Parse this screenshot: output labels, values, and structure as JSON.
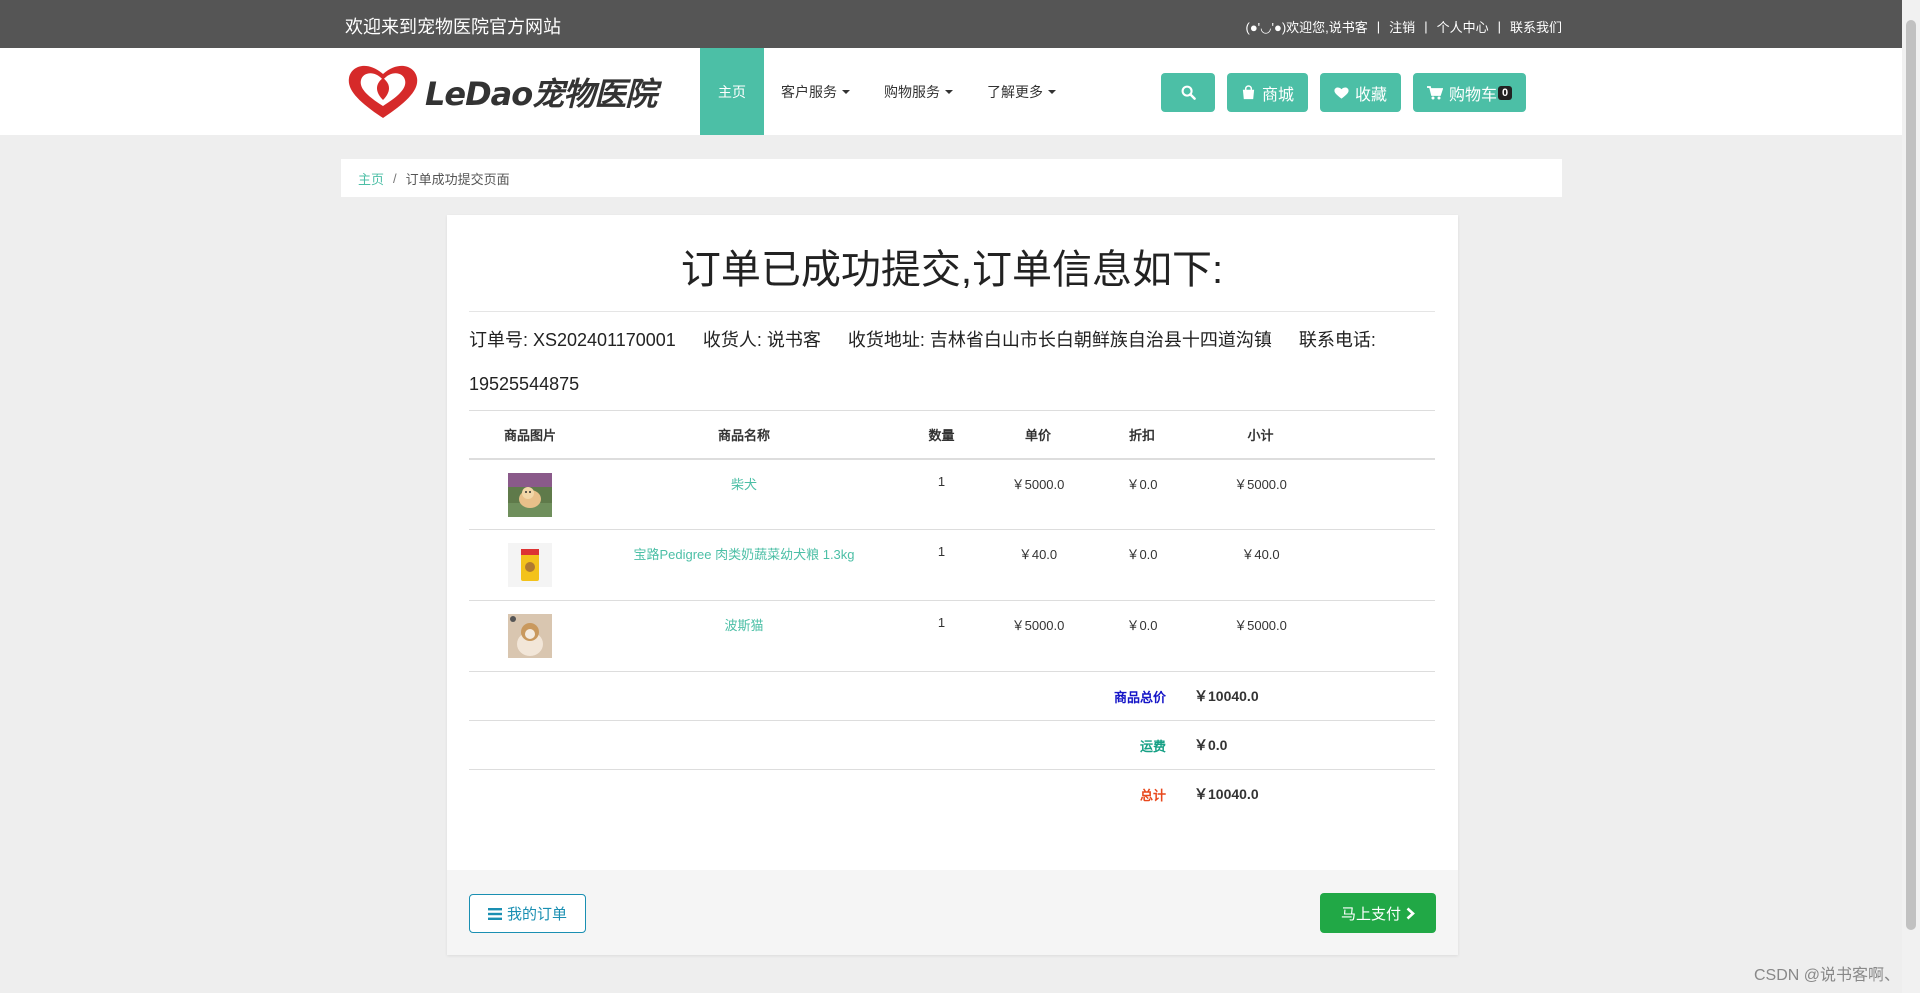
{
  "topbar": {
    "welcome": "欢迎来到宠物医院官方网站",
    "user_greeting": "(●'◡'●)欢迎您,说书客",
    "logout": "注销",
    "profile": "个人中心",
    "contact": "联系我们",
    "separator": "|"
  },
  "logo": {
    "text": "LeDao宠物医院",
    "icon": "heart-logo-icon",
    "color": "#d62a2a"
  },
  "nav": {
    "items": [
      {
        "label": "主页",
        "active": true
      },
      {
        "label": "客户服务",
        "dropdown": true
      },
      {
        "label": "购物服务",
        "dropdown": true
      },
      {
        "label": "了解更多",
        "dropdown": true
      }
    ],
    "buttons": {
      "search_icon": "search-icon",
      "shop": "商城",
      "favorites": "收藏",
      "cart": "购物车",
      "cart_count": "0"
    }
  },
  "breadcrumb": {
    "home": "主页",
    "separator": "/",
    "current": "订单成功提交页面"
  },
  "order": {
    "title": "订单已成功提交,订单信息如下:",
    "order_no": "订单号: XS202401170001",
    "receiver": "收货人: 说书客",
    "address": "收货地址: 吉林省白山市长白朝鲜族自治县十四道沟镇",
    "phone_label": "联系电话:",
    "phone": "19525544875"
  },
  "table": {
    "headers": [
      "商品图片",
      "商品名称",
      "数量",
      "单价",
      "折扣",
      "小计"
    ],
    "rows": [
      {
        "image": "shiba-dog-photo",
        "name": "柴犬",
        "qty": "1",
        "price": "￥5000.0",
        "discount": "￥0.0",
        "subtotal": "￥5000.0"
      },
      {
        "image": "dog-food-bag-photo",
        "name": "宝路Pedigree 肉类奶蔬菜幼犬粮 1.3kg",
        "qty": "1",
        "price": "￥40.0",
        "discount": "￥0.0",
        "subtotal": "￥40.0"
      },
      {
        "image": "persian-cat-photo",
        "name": "波斯猫",
        "qty": "1",
        "price": "￥5000.0",
        "discount": "￥0.0",
        "subtotal": "￥5000.0"
      }
    ],
    "summary": {
      "goods_total_label": "商品总价",
      "goods_total": "￥10040.0",
      "shipping_label": "运费",
      "shipping": "￥0.0",
      "grand_total_label": "总计",
      "grand_total": "￥10040.0"
    }
  },
  "footer": {
    "my_orders": "我的订单",
    "pay_now": "马上支付"
  },
  "colors": {
    "accent": "#4cbfa6",
    "pay": "#21a846",
    "goods_total": "#1515c7",
    "shipping": "#16a085",
    "grand_total": "#e8481c"
  },
  "watermark": "CSDN @说书客啊、"
}
